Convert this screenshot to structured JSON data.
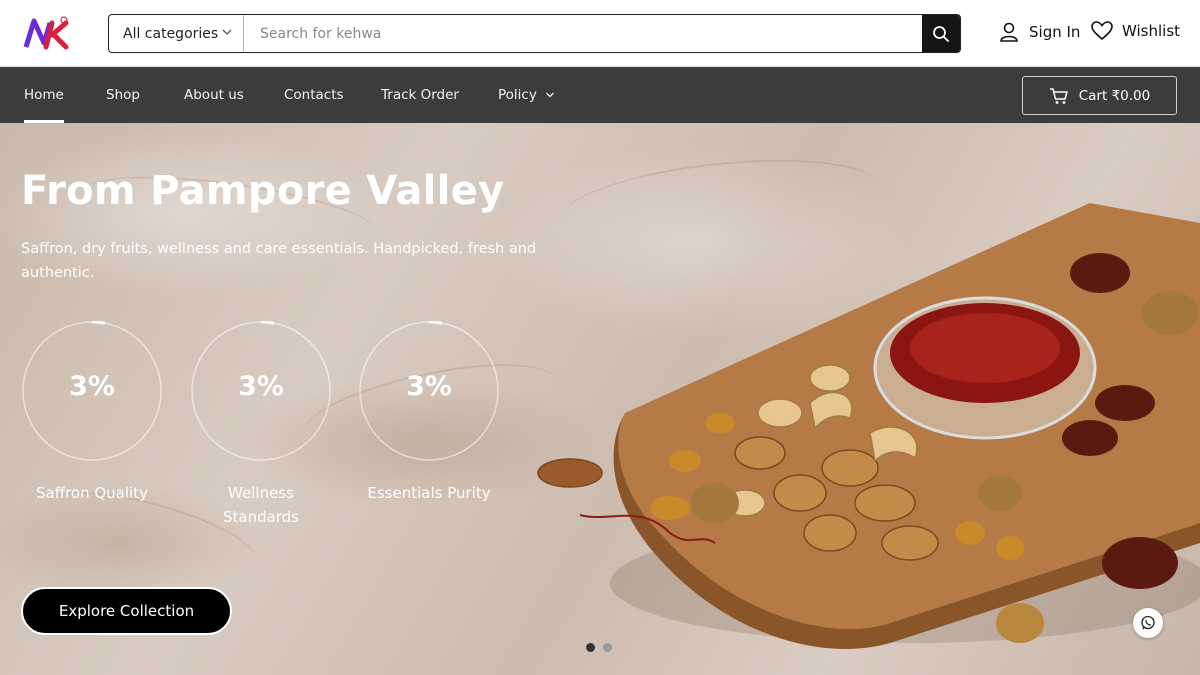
{
  "header": {
    "logo_text": "NK",
    "category_select": "All categories",
    "search_placeholder": "Search for kehwa",
    "sign_in": "Sign In",
    "wishlist": "Wishlist"
  },
  "nav": {
    "items": [
      {
        "label": "Home",
        "active": true
      },
      {
        "label": "Shop"
      },
      {
        "label": "About us"
      },
      {
        "label": "Contacts"
      },
      {
        "label": "Track Order"
      },
      {
        "label": "Policy"
      }
    ],
    "cart": "Cart ₹0.00"
  },
  "hero": {
    "title": "From Pampore Valley",
    "subtitle": "Saffron, dry fruits, wellness and care essentials. Handpicked, fresh and authentic.",
    "stats": [
      {
        "value": "3%",
        "progress": 0.03,
        "label": "Saffron Quality"
      },
      {
        "value": "3%",
        "progress": 0.03,
        "label": "Wellness Standards"
      },
      {
        "value": "3%",
        "progress": 0.03,
        "label": "Essentials Purity"
      }
    ],
    "cta": "Explore Collection",
    "slides": {
      "count": 2,
      "active": 1
    }
  },
  "colors": {
    "nav_bg": "#3c3c3c",
    "brand_red": "#d81f3c",
    "button_black": "#000000"
  }
}
